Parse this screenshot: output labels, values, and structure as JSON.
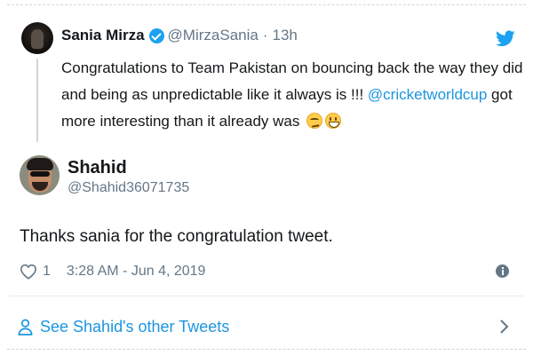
{
  "parent_tweet": {
    "name": "Sania Mirza",
    "handle": "@MirzaSania",
    "separator": "·",
    "time": "13h",
    "text_before_mention": "Congratulations to Team Pakistan on bouncing back the way they did and being as unpredictable like it always is !!! ",
    "mention": "@cricketworldcup",
    "text_after_mention": " got more interesting than it already was",
    "emojis": [
      "smirking-face",
      "grinning-face"
    ]
  },
  "reply_tweet": {
    "name": "Shahid",
    "handle": "@Shahid36071735",
    "text": "Thanks sania for the congratulation tweet.",
    "like_count": "1",
    "timestamp": "3:28 AM - Jun 4, 2019"
  },
  "footer": {
    "see_more_label": "See Shahid's other Tweets"
  },
  "icons": {
    "verified": "verified-badge-icon",
    "brand": "twitter-bird-icon",
    "like": "heart-icon",
    "info": "info-icon",
    "profile": "person-icon",
    "next": "chevron-right-icon"
  },
  "colors": {
    "accent": "#1DA1F2",
    "link": "#1B95E0",
    "text": "#14171A",
    "secondary_text": "#657786"
  }
}
